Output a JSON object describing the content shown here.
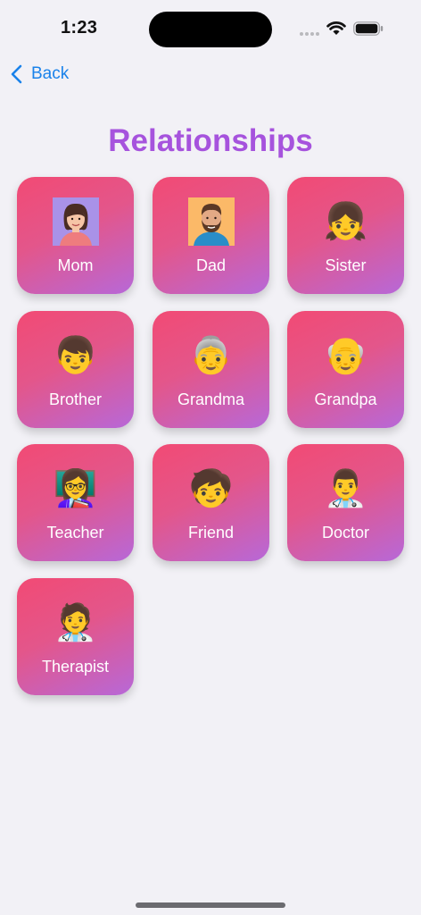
{
  "status_bar": {
    "time": "1:23"
  },
  "nav": {
    "back_label": "Back"
  },
  "page": {
    "title": "Relationships"
  },
  "tiles": [
    {
      "label": "Mom",
      "icon": "mom-avatar-icon"
    },
    {
      "label": "Dad",
      "icon": "dad-avatar-icon"
    },
    {
      "label": "Sister",
      "icon": "👧"
    },
    {
      "label": "Brother",
      "icon": "👦"
    },
    {
      "label": "Grandma",
      "icon": "👵"
    },
    {
      "label": "Grandpa",
      "icon": "👴"
    },
    {
      "label": "Teacher",
      "icon": "👩‍🏫"
    },
    {
      "label": "Friend",
      "icon": "🧒"
    },
    {
      "label": "Doctor",
      "icon": "👨‍⚕️"
    },
    {
      "label": "Therapist",
      "icon": "🧑‍⚕️"
    }
  ],
  "colors": {
    "accent": "#1a82ea",
    "title": "#a653dd",
    "tile_top": "#f24a74",
    "tile_bottom": "#b768d8"
  }
}
